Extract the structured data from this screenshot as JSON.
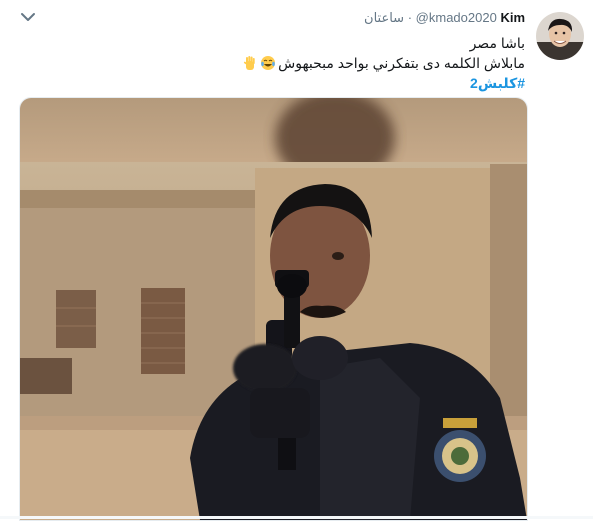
{
  "tweet": {
    "display_name": "Kim",
    "handle": "@kmado2020",
    "separator": "·",
    "timestamp": "ساعتان",
    "line1": "باشا مصر",
    "line2": "مابلاش الكلمه دى بتفكرني بواحد مبحبهوش",
    "hashtag": "#كلبش2"
  },
  "icons": {
    "caret": "chevron-down-icon",
    "emoji_1": "tears-of-joy-emoji",
    "emoji_2": "raised-hand-emoji"
  },
  "colors": {
    "link": "#1b95e0",
    "secondary_text": "#657786",
    "primary_text": "#14171a"
  }
}
